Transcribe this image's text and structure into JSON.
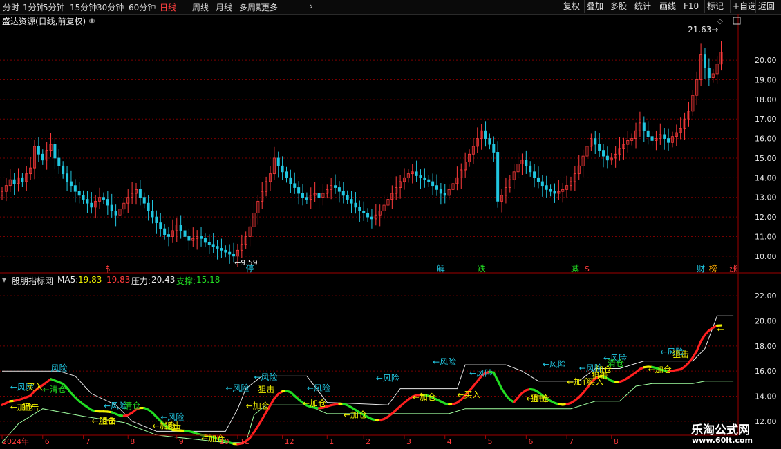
{
  "toolbar": {
    "periods": [
      "分时",
      "1分钟",
      "5分钟",
      "15分钟",
      "30分钟",
      "60分钟",
      "日线",
      "周线",
      "月线",
      "多周期",
      "更多"
    ],
    "active": "日线",
    "right": [
      "复权",
      "叠加",
      "多股",
      "统计",
      "画线",
      "F10",
      "标记",
      "+自选",
      "返回"
    ]
  },
  "stock": {
    "title": "盛达资源(日线,前复权)"
  },
  "indicator": {
    "name": "股朋指标网",
    "ma5_label": "MA5:",
    "ma5_value": "19.83",
    "ma5_value2": "19.83",
    "pressure_label": "压力:",
    "pressure_value": "20.43",
    "support_label": "支撑:",
    "support_value": "15.18"
  },
  "watermark": {
    "line1": "乐淘公式网",
    "line2": "www.60lt.com"
  },
  "colors": {
    "up": "#ff3b3b",
    "down": "#21c6e0",
    "grid": "#7a0000",
    "signal_red": "#ff2020",
    "signal_green": "#22dd22",
    "signal_yellow": "#f0f000",
    "pressure": "#e8e8e8",
    "support": "#a0ffa0"
  },
  "chart_data": [
    {
      "type": "candlestick",
      "title": "盛达资源(日线,前复权)",
      "y_ticks": [
        "10.00",
        "11.00",
        "12.00",
        "13.00",
        "14.00",
        "15.00",
        "16.00",
        "17.00",
        "18.00",
        "19.00",
        "20.00"
      ],
      "ylim": [
        9.5,
        21.8
      ],
      "high_label": "21.63",
      "low_label": "9.59",
      "event_markers": [
        {
          "label": "$",
          "day": 26,
          "color": "#ff3b3b"
        },
        {
          "label": "停",
          "day": 61,
          "color": "#21c6e0"
        },
        {
          "label": "解",
          "day": 108,
          "color": "#21c6e0"
        },
        {
          "label": "跌",
          "day": 118,
          "color": "#22dd22"
        },
        {
          "label": "减",
          "day": 141,
          "color": "#22dd22"
        },
        {
          "label": "$",
          "day": 144,
          "color": "#ff3b3b"
        },
        {
          "label": "财",
          "day": 172,
          "color": "#21c6e0"
        },
        {
          "label": "榜",
          "day": 175,
          "color": "#f0a000"
        },
        {
          "label": "涨",
          "day": 180,
          "color": "#ff3b3b"
        }
      ],
      "closes": [
        13.3,
        13.6,
        13.9,
        13.7,
        14.0,
        13.8,
        14.2,
        14.5,
        15.6,
        15.2,
        14.9,
        15.4,
        15.7,
        15.0,
        14.6,
        14.2,
        13.8,
        13.6,
        13.3,
        13.1,
        12.9,
        12.7,
        12.5,
        12.8,
        13.0,
        12.9,
        12.6,
        12.3,
        12.1,
        12.4,
        12.7,
        13.0,
        13.2,
        13.4,
        13.0,
        12.7,
        12.3,
        12.0,
        11.7,
        11.4,
        11.1,
        11.0,
        11.3,
        11.6,
        11.3,
        11.0,
        10.8,
        10.9,
        11.0,
        10.9,
        10.7,
        10.6,
        10.5,
        10.4,
        10.3,
        10.2,
        10.1,
        10.0,
        10.3,
        10.6,
        11.0,
        11.5,
        12.2,
        12.8,
        13.3,
        13.8,
        14.2,
        15.0,
        14.6,
        14.3,
        14.0,
        13.7,
        13.5,
        13.2,
        13.0,
        12.9,
        13.1,
        13.2,
        13.0,
        13.2,
        13.4,
        13.6,
        13.5,
        13.3,
        13.1,
        12.9,
        12.7,
        12.5,
        12.3,
        12.2,
        12.0,
        11.9,
        12.1,
        12.3,
        12.6,
        12.9,
        13.2,
        13.5,
        13.8,
        14.0,
        14.2,
        14.3,
        14.1,
        14.0,
        13.9,
        13.8,
        13.6,
        13.4,
        13.2,
        13.1,
        13.4,
        13.7,
        14.0,
        14.4,
        14.8,
        15.2,
        15.6,
        16.0,
        16.4,
        16.0,
        15.7,
        15.3,
        12.8,
        13.1,
        13.5,
        13.9,
        14.3,
        14.7,
        14.9,
        14.6,
        14.3,
        14.0,
        13.8,
        13.6,
        13.4,
        13.3,
        13.2,
        13.3,
        13.4,
        13.6,
        13.8,
        14.2,
        14.6,
        15.1,
        15.6,
        16.0,
        15.7,
        15.4,
        15.1,
        14.9,
        15.0,
        15.2,
        15.5,
        15.7,
        15.9,
        16.0,
        16.4,
        16.8,
        16.4,
        16.1,
        15.9,
        16.0,
        16.2,
        16.0,
        15.8,
        16.1,
        16.3,
        16.5,
        17.0,
        17.4,
        18.2,
        19.0,
        20.3,
        19.6,
        19.1,
        19.3,
        19.8,
        20.4
      ]
    },
    {
      "type": "line",
      "title": "股朋指标网",
      "y_ticks": [
        "12.00",
        "14.00",
        "16.00",
        "18.00",
        "20.00",
        "22.00"
      ],
      "ylim": [
        11.0,
        23.0
      ],
      "series": [
        {
          "name": "MA5"
        },
        {
          "name": "压力"
        },
        {
          "name": "支撑"
        }
      ],
      "pressure_steps": [
        [
          0,
          16.0
        ],
        [
          14,
          16.0
        ],
        [
          18,
          15.6
        ],
        [
          22,
          14.2
        ],
        [
          28,
          13.3
        ],
        [
          32,
          12.0
        ],
        [
          38,
          11.2
        ],
        [
          55,
          11.2
        ],
        [
          58,
          13.0
        ],
        [
          60,
          14.6
        ],
        [
          64,
          15.6
        ],
        [
          75,
          15.6
        ],
        [
          80,
          13.5
        ],
        [
          95,
          13.3
        ],
        [
          98,
          14.6
        ],
        [
          112,
          14.6
        ],
        [
          114,
          16.5
        ],
        [
          124,
          16.5
        ],
        [
          128,
          16.0
        ],
        [
          132,
          15.2
        ],
        [
          142,
          15.2
        ],
        [
          146,
          16.2
        ],
        [
          152,
          16.2
        ],
        [
          158,
          16.8
        ],
        [
          170,
          16.8
        ],
        [
          173,
          17.8
        ],
        [
          176,
          20.4
        ],
        [
          180,
          20.4
        ]
      ],
      "support_steps": [
        [
          0,
          10.3
        ],
        [
          4,
          11.8
        ],
        [
          10,
          13.0
        ],
        [
          20,
          12.4
        ],
        [
          30,
          11.9
        ],
        [
          38,
          10.9
        ],
        [
          55,
          10.3
        ],
        [
          60,
          10.3
        ],
        [
          62,
          12.5
        ],
        [
          65,
          13.3
        ],
        [
          75,
          13.3
        ],
        [
          80,
          12.6
        ],
        [
          95,
          12.6
        ],
        [
          98,
          12.6
        ],
        [
          110,
          12.6
        ],
        [
          114,
          13.0
        ],
        [
          124,
          13.0
        ],
        [
          140,
          13.0
        ],
        [
          146,
          13.6
        ],
        [
          152,
          13.6
        ],
        [
          156,
          14.8
        ],
        [
          160,
          15.0
        ],
        [
          170,
          15.0
        ],
        [
          173,
          15.2
        ],
        [
          180,
          15.2
        ]
      ],
      "signals": [
        {
          "label": "←风险",
          "day": 2,
          "value": 14.5,
          "color": "#21c6e0"
        },
        {
          "label": "买入",
          "day": 6,
          "value": 14.5,
          "color": "#f0f000"
        },
        {
          "label": "←清仓",
          "day": 10,
          "value": 14.3,
          "color": "#22dd22"
        },
        {
          "label": "←加仓",
          "day": 2,
          "value": 12.9,
          "color": "#f0f000"
        },
        {
          "label": "狙击",
          "day": 5,
          "value": 12.9,
          "color": "#f0f000"
        },
        {
          "label": "风险",
          "day": 12,
          "value": 16.0,
          "color": "#21c6e0"
        },
        {
          "label": "←风险",
          "day": 25,
          "value": 13.0,
          "color": "#21c6e0"
        },
        {
          "label": "清仓",
          "day": 30,
          "value": 13.0,
          "color": "#22dd22"
        },
        {
          "label": "←加仓",
          "day": 22,
          "value": 11.8,
          "color": "#f0f000"
        },
        {
          "label": "狙击",
          "day": 24,
          "value": 11.8,
          "color": "#f0f000"
        },
        {
          "label": "←风险",
          "day": 39,
          "value": 12.1,
          "color": "#21c6e0"
        },
        {
          "label": "←加仓",
          "day": 37,
          "value": 11.4,
          "color": "#f0f000"
        },
        {
          "label": "狙击",
          "day": 40,
          "value": 11.4,
          "color": "#f0f000"
        },
        {
          "label": "←加仓",
          "day": 49,
          "value": 10.4,
          "color": "#f0f000"
        },
        {
          "label": "←风险",
          "day": 55,
          "value": 14.4,
          "color": "#21c6e0"
        },
        {
          "label": "←风险",
          "day": 62,
          "value": 15.3,
          "color": "#21c6e0"
        },
        {
          "label": "狙击",
          "day": 63,
          "value": 14.3,
          "color": "#f0f000"
        },
        {
          "label": "←加仓",
          "day": 60,
          "value": 13.0,
          "color": "#f0f000"
        },
        {
          "label": "←风险",
          "day": 75,
          "value": 14.4,
          "color": "#21c6e0"
        },
        {
          "label": "←加仓",
          "day": 74,
          "value": 13.2,
          "color": "#f0f000"
        },
        {
          "label": "←加仓",
          "day": 84,
          "value": 12.3,
          "color": "#f0f000"
        },
        {
          "label": "←风险",
          "day": 92,
          "value": 15.2,
          "color": "#21c6e0"
        },
        {
          "label": "←加仓",
          "day": 101,
          "value": 13.7,
          "color": "#f0f000"
        },
        {
          "label": "←风险",
          "day": 106,
          "value": 16.5,
          "color": "#21c6e0"
        },
        {
          "label": "←风险",
          "day": 115,
          "value": 15.6,
          "color": "#21c6e0"
        },
        {
          "label": "←买入",
          "day": 112,
          "value": 13.9,
          "color": "#f0f000"
        },
        {
          "label": "←加仓",
          "day": 129,
          "value": 13.6,
          "color": "#f0f000"
        },
        {
          "label": "狙击",
          "day": 130,
          "value": 13.6,
          "color": "#f0f000"
        },
        {
          "label": "←风险",
          "day": 133,
          "value": 16.3,
          "color": "#21c6e0"
        },
        {
          "label": "←风险",
          "day": 142,
          "value": 16.0,
          "color": "#21c6e0"
        },
        {
          "label": "狙击",
          "day": 145,
          "value": 15.4,
          "color": "#f0f000"
        },
        {
          "label": "←加仓",
          "day": 139,
          "value": 14.9,
          "color": "#f0f000"
        },
        {
          "label": "买入",
          "day": 144,
          "value": 14.9,
          "color": "#f0f000"
        },
        {
          "label": "←风险",
          "day": 148,
          "value": 16.8,
          "color": "#21c6e0"
        },
        {
          "label": "清仓",
          "day": 149,
          "value": 16.4,
          "color": "#22dd22"
        },
        {
          "label": "加仓",
          "day": 146,
          "value": 15.9,
          "color": "#f0f000"
        },
        {
          "label": "←加仓",
          "day": 159,
          "value": 15.9,
          "color": "#f0f000"
        },
        {
          "label": "←风险",
          "day": 162,
          "value": 17.3,
          "color": "#21c6e0"
        },
        {
          "label": "狙击",
          "day": 165,
          "value": 17.1,
          "color": "#f0f000"
        },
        {
          "label": "←",
          "day": 176,
          "value": 19.1,
          "color": "#f0f000"
        }
      ]
    }
  ],
  "x_axis": {
    "labels": [
      {
        "label": "2024年",
        "day": 0
      },
      {
        "label": "6",
        "day": 10
      },
      {
        "label": "7",
        "day": 20
      },
      {
        "label": "8",
        "day": 31
      },
      {
        "label": "9",
        "day": 43
      },
      {
        "label": "10",
        "day": 53
      },
      {
        "label": "11",
        "day": 58
      },
      {
        "label": "12",
        "day": 69
      },
      {
        "label": "1",
        "day": 80
      },
      {
        "label": "2",
        "day": 89
      },
      {
        "label": "3",
        "day": 99
      },
      {
        "label": "4",
        "day": 109
      },
      {
        "label": "5",
        "day": 119
      },
      {
        "label": "6",
        "day": 129
      },
      {
        "label": "7",
        "day": 139
      },
      {
        "label": "8",
        "day": 150
      }
    ]
  }
}
